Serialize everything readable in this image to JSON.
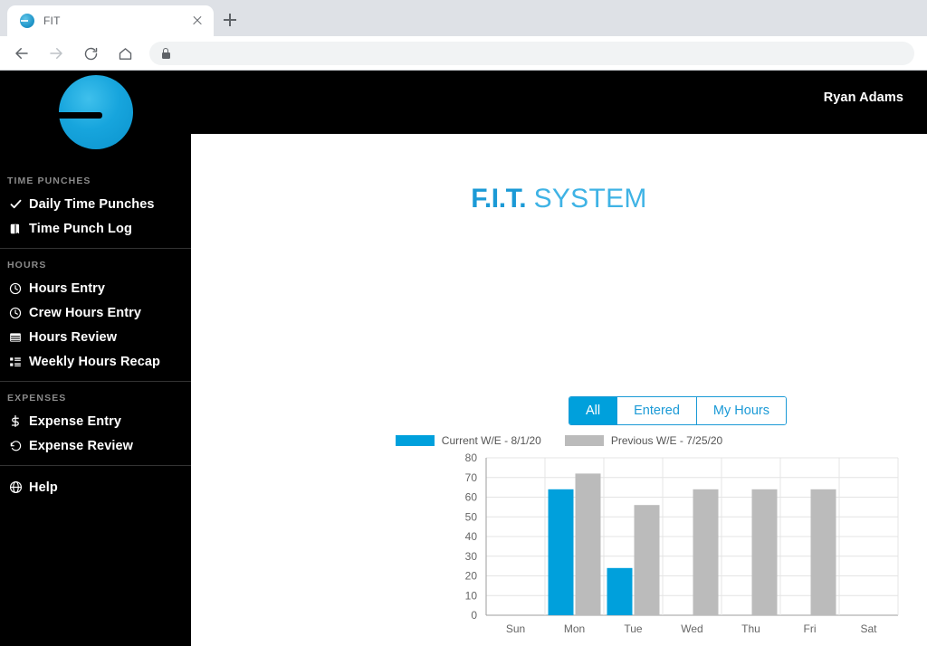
{
  "browser": {
    "tab_title": "FIT",
    "favicon": "fit-logo-icon",
    "close_icon": "close-icon",
    "new_tab_icon": "plus-icon",
    "back_icon": "back-arrow-icon",
    "forward_icon": "forward-arrow-icon",
    "reload_icon": "reload-icon",
    "home_icon": "home-icon",
    "lock_icon": "lock-icon",
    "url": ""
  },
  "app": {
    "logo": "fit-logo-icon",
    "user_name": "Ryan Adams",
    "title_bold": "F.I.T.",
    "title_regular": "SYSTEM"
  },
  "sidebar": {
    "sections": [
      {
        "heading": "TIME PUNCHES",
        "items": [
          {
            "label": "Daily Time Punches",
            "icon": "check-icon"
          },
          {
            "label": "Time Punch Log",
            "icon": "book-icon"
          }
        ]
      },
      {
        "heading": "HOURS",
        "items": [
          {
            "label": "Hours Entry",
            "icon": "clock-icon"
          },
          {
            "label": "Crew Hours Entry",
            "icon": "clock-icon"
          },
          {
            "label": "Hours Review",
            "icon": "table-icon"
          },
          {
            "label": "Weekly Hours Recap",
            "icon": "list-icon"
          }
        ]
      },
      {
        "heading": "EXPENSES",
        "items": [
          {
            "label": "Expense Entry",
            "icon": "dollar-icon"
          },
          {
            "label": "Expense Review",
            "icon": "undo-icon"
          }
        ]
      },
      {
        "heading": "",
        "items": [
          {
            "label": "Help",
            "icon": "help-icon"
          }
        ]
      }
    ]
  },
  "tabs": [
    {
      "label": "All",
      "active": true
    },
    {
      "label": "Entered",
      "active": false
    },
    {
      "label": "My Hours",
      "active": false
    }
  ],
  "colors": {
    "accent_blue": "#00a0dc",
    "title_blue": "#1b9ad6",
    "bar_gray": "#bbbbbb",
    "sidebar_bg": "#000000"
  },
  "chart_data": {
    "type": "bar",
    "title": "",
    "xlabel": "",
    "ylabel": "",
    "categories": [
      "Sun",
      "Mon",
      "Tue",
      "Wed",
      "Thu",
      "Fri",
      "Sat"
    ],
    "series": [
      {
        "name": "Current W/E - 8/1/20",
        "color": "#00a0dc",
        "values": [
          0,
          64,
          24,
          0,
          0,
          0,
          0
        ]
      },
      {
        "name": "Previous W/E - 7/25/20",
        "color": "#bbbbbb",
        "values": [
          0,
          72,
          56,
          64,
          64,
          64,
          0
        ]
      }
    ],
    "ylim": [
      0,
      80
    ],
    "yticks": [
      0,
      10,
      20,
      30,
      40,
      50,
      60,
      70,
      80
    ],
    "grid": true,
    "legend_position": "top"
  }
}
